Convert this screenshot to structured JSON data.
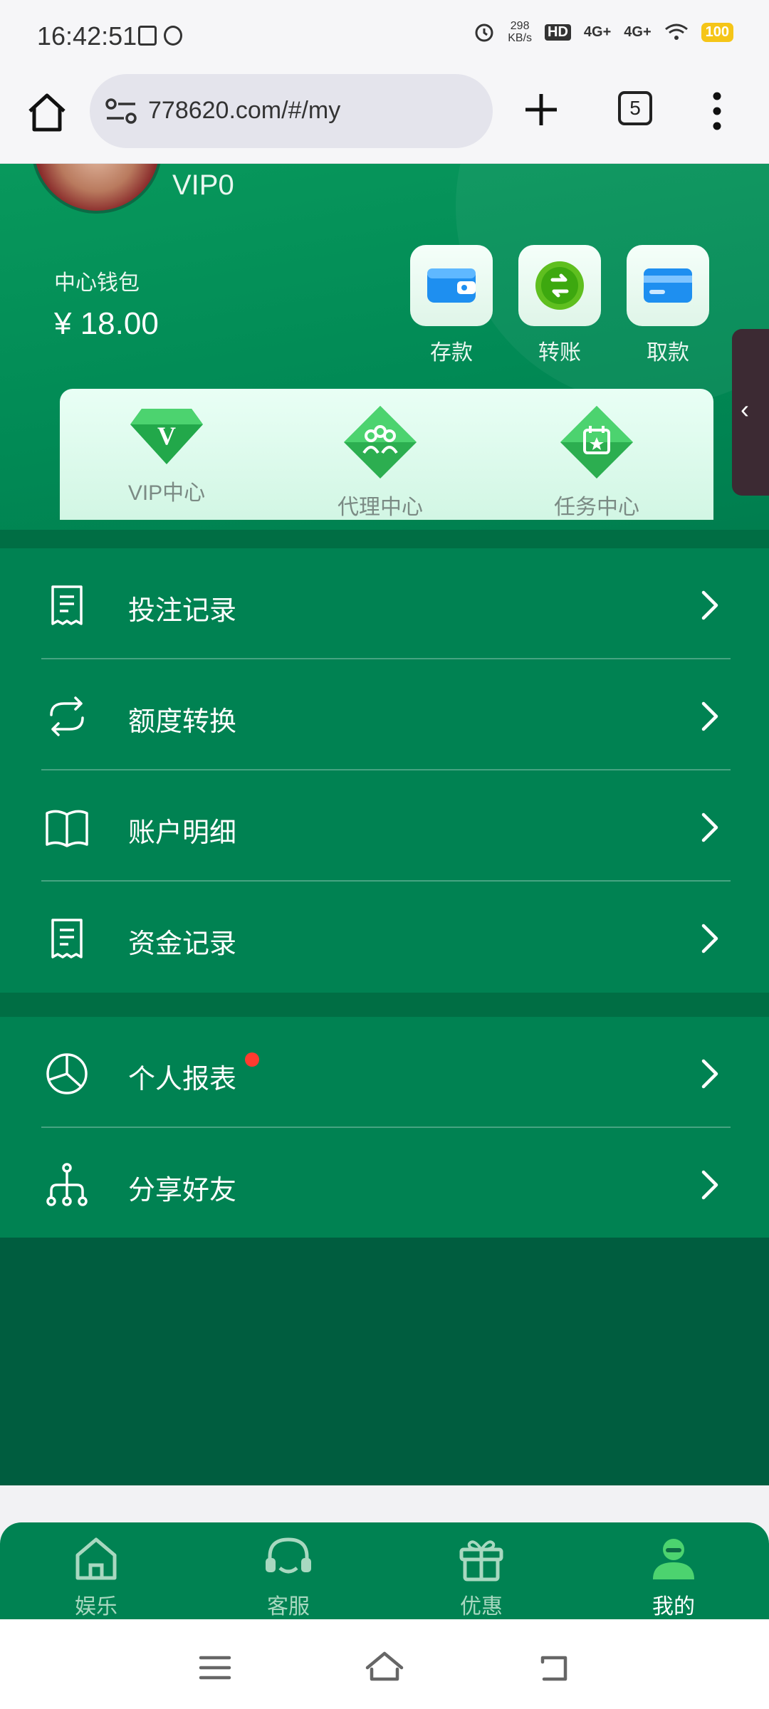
{
  "status_bar": {
    "time": "16:42:51",
    "net_speed_value": "298",
    "net_speed_unit": "KB/s",
    "hd_label": "HD",
    "signal1": "4G+",
    "signal2": "4G+",
    "battery": "100"
  },
  "browser": {
    "url": "778620.com/#/my",
    "tab_count": "5"
  },
  "profile": {
    "vip_level": "VIP0",
    "wallet_label": "中心钱包",
    "wallet_amount": "¥ 18.00"
  },
  "quick_actions": [
    {
      "label": "存款",
      "icon": "wallet-icon"
    },
    {
      "label": "转账",
      "icon": "transfer-icon"
    },
    {
      "label": "取款",
      "icon": "card-icon"
    }
  ],
  "center_links": [
    {
      "label": "VIP中心",
      "icon": "vip-diamond-icon"
    },
    {
      "label": "代理中心",
      "icon": "agent-icon"
    },
    {
      "label": "任务中心",
      "icon": "task-icon"
    }
  ],
  "menu_group_1": [
    {
      "label": "投注记录",
      "icon": "receipt-icon"
    },
    {
      "label": "额度转换",
      "icon": "refresh-icon"
    },
    {
      "label": "账户明细",
      "icon": "book-icon"
    },
    {
      "label": "资金记录",
      "icon": "receipt-icon"
    }
  ],
  "menu_group_2": [
    {
      "label": "个人报表",
      "icon": "pie-chart-icon",
      "badge": true
    },
    {
      "label": "分享好友",
      "icon": "share-tree-icon"
    }
  ],
  "bottom_nav": [
    {
      "label": "娱乐",
      "icon": "home-icon",
      "active": false
    },
    {
      "label": "客服",
      "icon": "headset-icon",
      "active": false
    },
    {
      "label": "优惠",
      "icon": "gift-icon",
      "active": false
    },
    {
      "label": "我的",
      "icon": "user-icon",
      "active": true
    }
  ],
  "colors": {
    "primary_green": "#008252",
    "dark_green": "#005d3f",
    "badge_red": "#ff3b2f",
    "battery_yellow": "#f5c518"
  }
}
